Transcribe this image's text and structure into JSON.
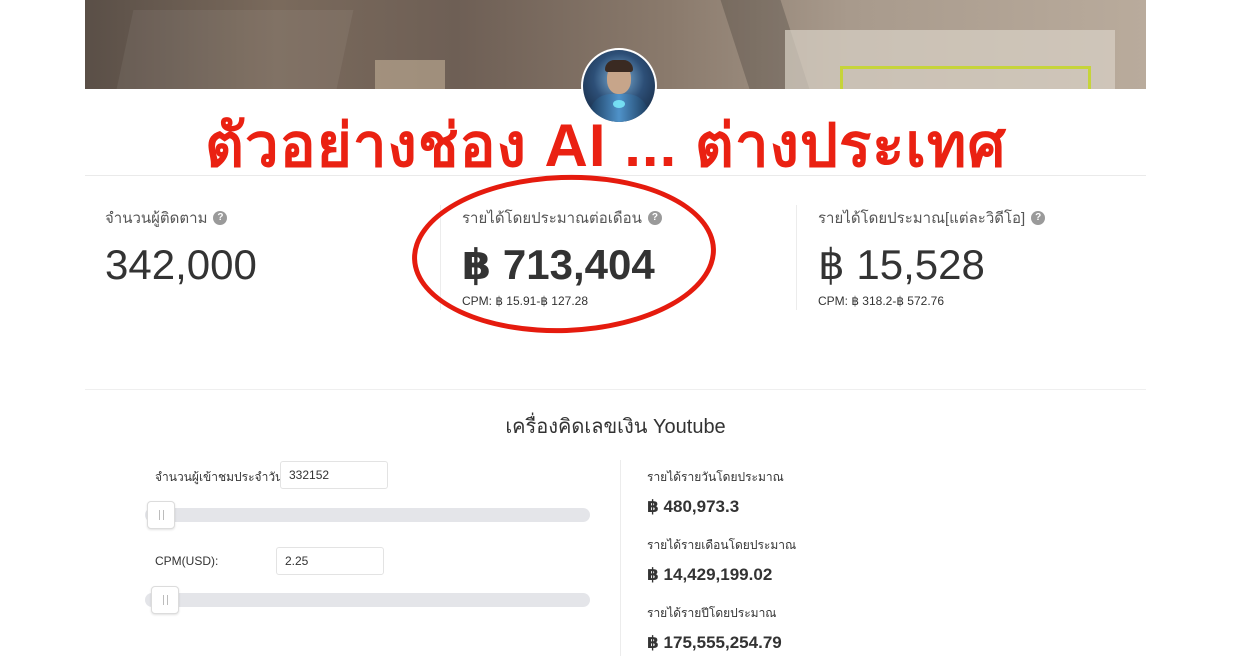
{
  "headline": "ตัวอย่างช่อง AI ... ต่างประเทศ",
  "stats": [
    {
      "label": "จำนวนผู้ติดตาม",
      "value": "342,000"
    },
    {
      "label": "รายได้โดยประมาณต่อเดือน",
      "value": "฿ 713,404",
      "cpm": "CPM: ฿ 15.91-฿ 127.28"
    },
    {
      "label": "รายได้โดยประมาณ[แต่ละวิดีโอ]",
      "value": "฿ 15,528",
      "cpm": "CPM: ฿ 318.2-฿ 572.76"
    }
  ],
  "help_icon": "?",
  "calculator": {
    "title": "เครื่องคิดเลขเงิน Youtube",
    "daily_views_label": "จำนวนผู้เข้าชมประจำวัน:",
    "daily_views_value": "332152",
    "daily_views_slider_fraction": 0.01,
    "cpm_label": "CPM(USD):",
    "cpm_value": "2.25",
    "cpm_slider_fraction": 0.02,
    "results": [
      {
        "label": "รายได้รายวันโดยประมาณ",
        "value": "฿ 480,973.3"
      },
      {
        "label": "รายได้รายเดือนโดยประมาณ",
        "value": "฿ 14,429,199.02"
      },
      {
        "label": "รายได้รายปีโดยประมาณ",
        "value": "฿ 175,555,254.79"
      }
    ]
  },
  "colors": {
    "highlight": "#e51b0e",
    "text": "#333333"
  },
  "icons": [
    "help-icon",
    "slider-grip-icon"
  ]
}
